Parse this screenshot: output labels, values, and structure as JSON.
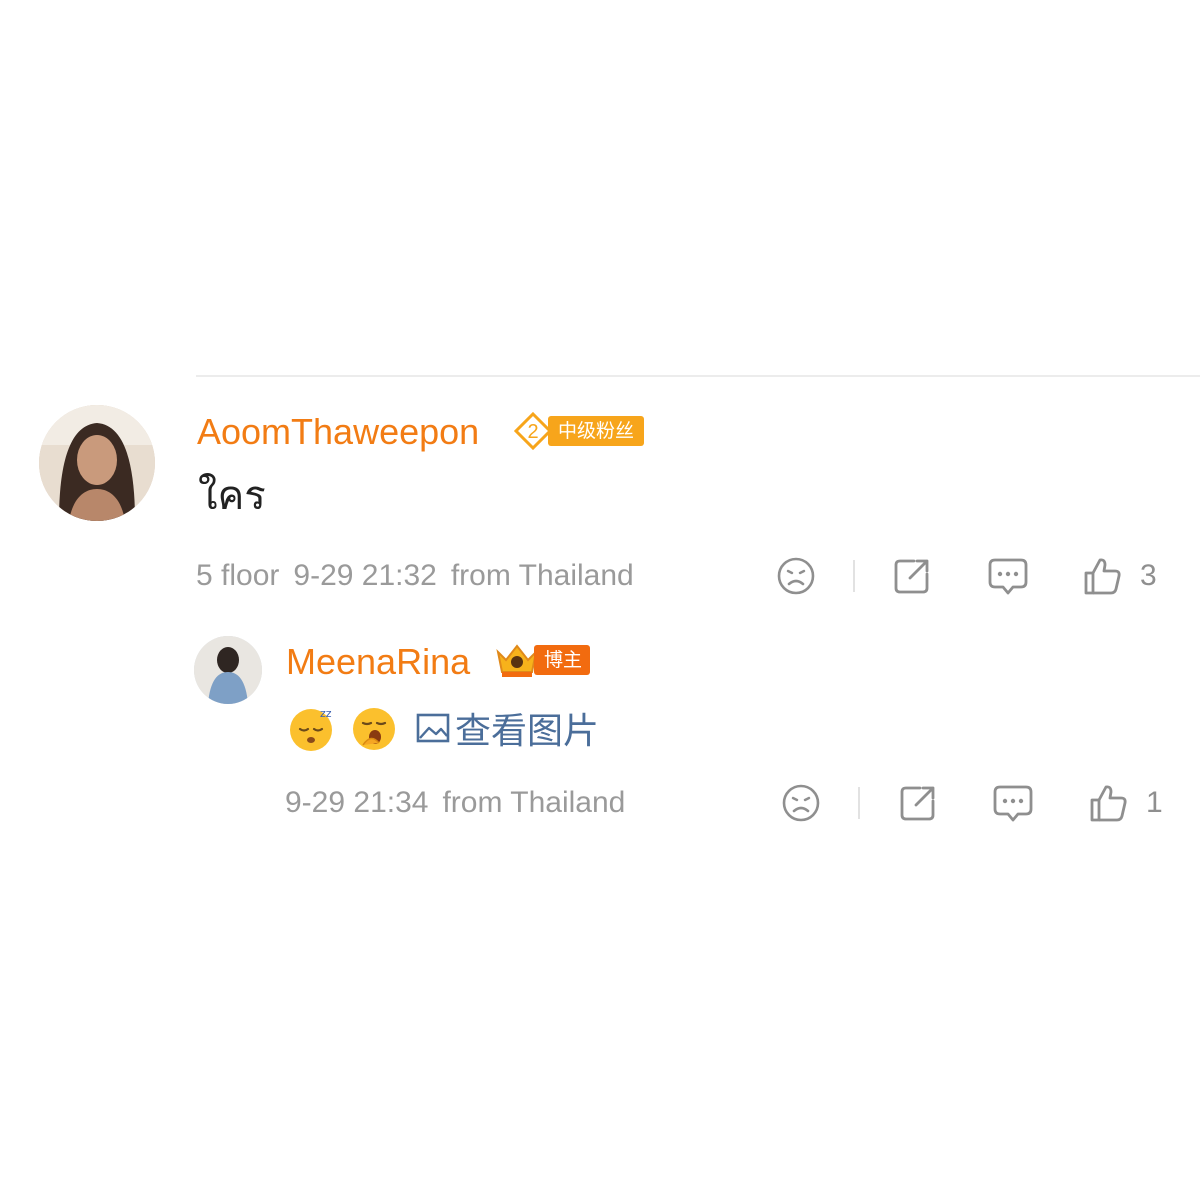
{
  "comment": {
    "username": "AoomThaweepon",
    "badge": {
      "level": "2",
      "label": "中级粉丝"
    },
    "text": "ใคร",
    "meta": {
      "floor": "5 floor",
      "datetime": "9-29 21:32",
      "location": "from Thailand"
    },
    "likes": "3"
  },
  "reply": {
    "username": "MeenaRina",
    "badge": {
      "label": "博主"
    },
    "view_image_label": "查看图片",
    "meta": {
      "datetime": "9-29 21:34",
      "location": "from Thailand"
    },
    "likes": "1"
  },
  "icons": [
    "dislike-icon",
    "share-icon",
    "comment-icon",
    "like-icon",
    "image-icon"
  ],
  "colors": {
    "username": "#f27c14",
    "fan_badge": "#f7a51b",
    "host_badge": "#f26b0f",
    "link": "#4b6e9a",
    "meta": "#9a9a9a"
  }
}
